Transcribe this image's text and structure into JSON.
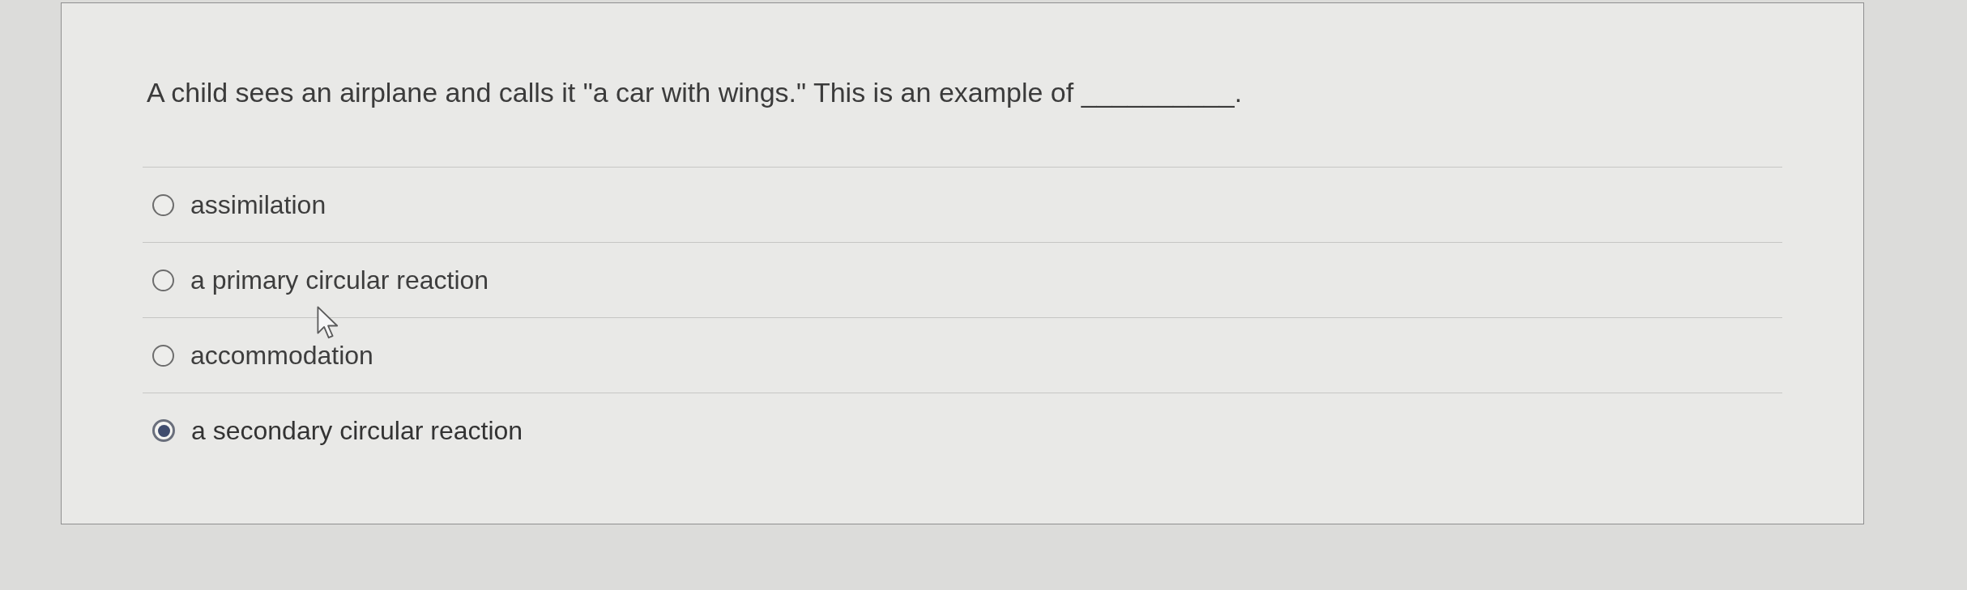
{
  "question": {
    "text": "A child sees an airplane and calls it \"a car with wings.\" This is an example of __________."
  },
  "options": [
    {
      "label": "assimilation",
      "selected": false
    },
    {
      "label": "a primary circular reaction",
      "selected": false
    },
    {
      "label": "accommodation",
      "selected": false
    },
    {
      "label": "a secondary circular reaction",
      "selected": true
    }
  ]
}
